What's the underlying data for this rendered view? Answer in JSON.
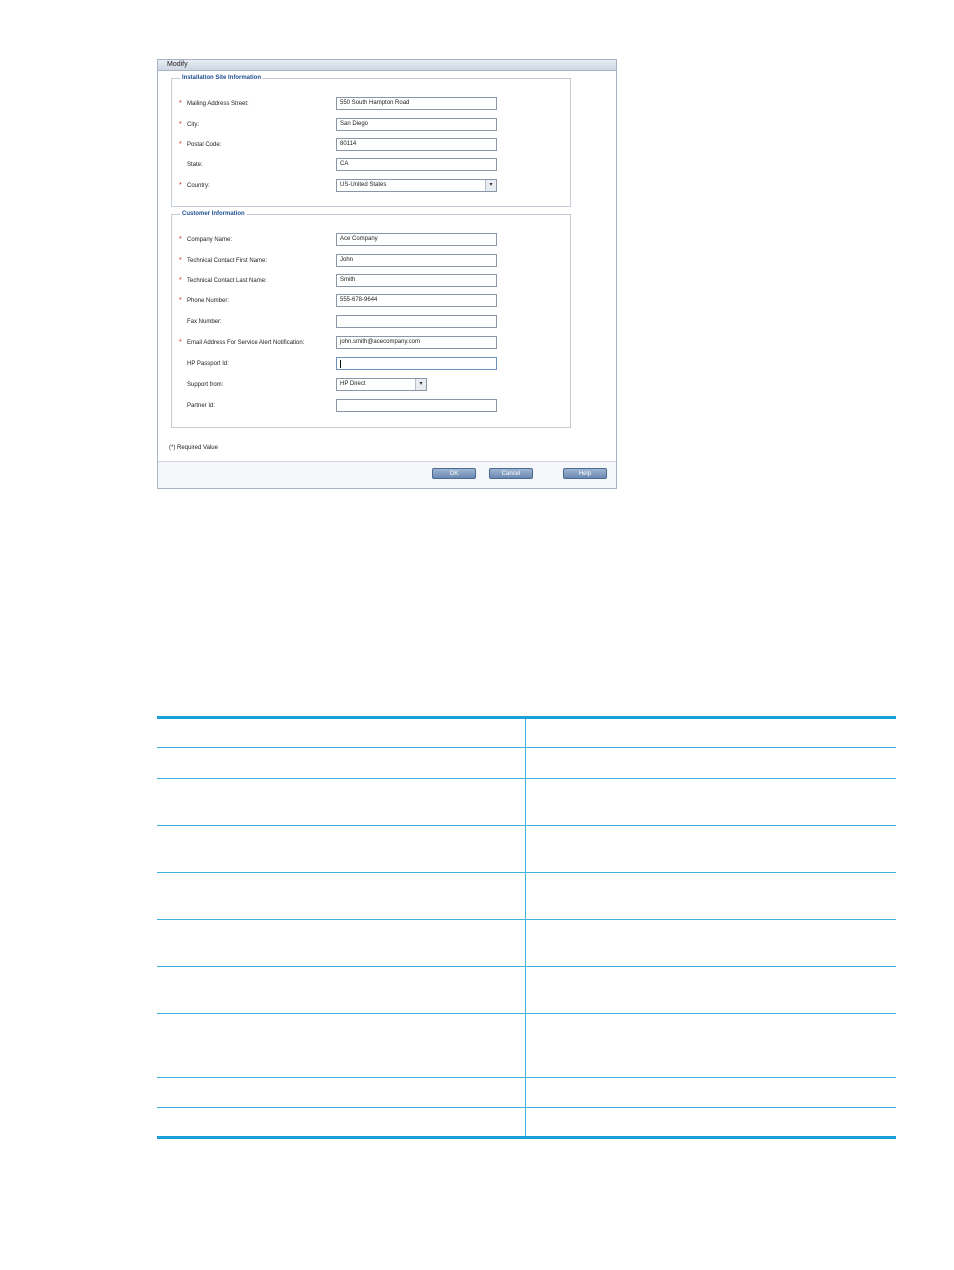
{
  "dialog": {
    "title": "Modify",
    "installation_section": {
      "legend": "Installation Site Information",
      "fields": {
        "street": {
          "label": "Mailing Address Street:",
          "value": "550 South Hampton Road"
        },
        "city": {
          "label": "City:",
          "value": "San Diego"
        },
        "postal": {
          "label": "Postal Code:",
          "value": "80114"
        },
        "state": {
          "label": "State:",
          "value": "CA"
        },
        "country": {
          "label": "Country:",
          "value": "US-United States"
        }
      }
    },
    "customer_section": {
      "legend": "Customer Information",
      "fields": {
        "company": {
          "label": "Company Name:",
          "value": "Ace Company"
        },
        "first": {
          "label": "Technical Contact First Name:",
          "value": "John"
        },
        "last": {
          "label": "Technical Contact Last Name:",
          "value": "Smith"
        },
        "phone": {
          "label": "Phone Number:",
          "value": "555-678-9644"
        },
        "fax": {
          "label": "Fax Number:",
          "value": ""
        },
        "email": {
          "label": "Email Address For Service Alert Notification:",
          "value": "john.smith@acecompany.com"
        },
        "passport": {
          "label": "HP Passport Id:",
          "value": ""
        },
        "support": {
          "label": "Support from:",
          "value": "HP Direct"
        },
        "partner": {
          "label": "Partner Id:",
          "value": ""
        }
      }
    },
    "required_mark": "*",
    "footnote": "(*) Required Value",
    "buttons": {
      "ok": "OK",
      "cancel": "Cancel",
      "help": "Help"
    },
    "dropdown_arrow": "▾"
  },
  "table": {
    "rows": 9
  }
}
